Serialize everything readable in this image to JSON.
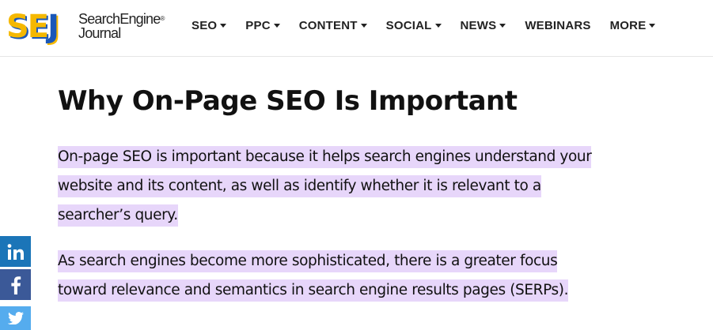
{
  "header": {
    "logo": {
      "mark": "SEJ",
      "name_line1": "SearchEngine",
      "registered": "®",
      "name_line2": "Journal"
    },
    "nav": [
      {
        "label": "SEO",
        "dropdown": true
      },
      {
        "label": "PPC",
        "dropdown": true
      },
      {
        "label": "CONTENT",
        "dropdown": true
      },
      {
        "label": "SOCIAL",
        "dropdown": true
      },
      {
        "label": "NEWS",
        "dropdown": true
      },
      {
        "label": "WEBINARS",
        "dropdown": false
      },
      {
        "label": "MORE",
        "dropdown": true
      }
    ]
  },
  "article": {
    "heading": "Why On-Page SEO Is Important",
    "paragraphs": [
      "On-page SEO is important because it helps search engines understand your website and its content, as well as identify whether it is relevant to a searcher’s query.",
      "As search engines become more sophisticated, there is a greater focus toward relevance and semantics in search engine results pages (SERPs)."
    ],
    "highlight_color": "#e7d6fa"
  },
  "share_bar": [
    {
      "network": "linkedin",
      "icon": "linkedin-icon",
      "color": "#1b75b8"
    },
    {
      "network": "facebook",
      "icon": "facebook-icon",
      "color": "#3b5998"
    },
    {
      "network": "twitter",
      "icon": "twitter-icon",
      "color": "#55acee"
    }
  ],
  "colors": {
    "logo_yellow": "#f5b800",
    "logo_blue": "#1a57b8",
    "text": "#111111"
  }
}
